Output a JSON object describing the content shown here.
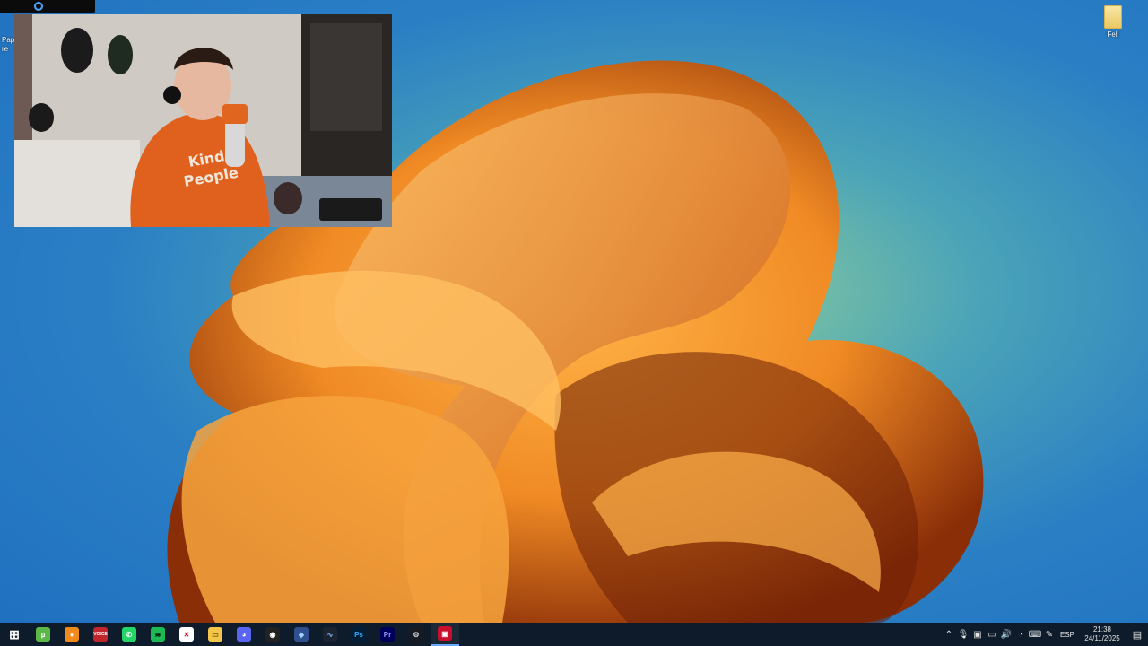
{
  "desktop": {
    "left_icon_label": "Pap re",
    "right_icon_label": "Feli"
  },
  "taskbar": {
    "apps": [
      {
        "name": "start-button",
        "glyph": "⊞",
        "bg": "#0d1b2a",
        "color": "#ffffff"
      },
      {
        "name": "app-utorrent",
        "glyph": "µ",
        "bg": "#5cb947",
        "color": "#ffffff"
      },
      {
        "name": "app-fl-studio",
        "glyph": "♦",
        "bg": "#f08a1c",
        "color": "#ffffff"
      },
      {
        "name": "app-voicemeeter",
        "glyph": "VOICE",
        "bg": "#c0262c",
        "color": "#ffffff"
      },
      {
        "name": "app-whatsapp",
        "glyph": "✆",
        "bg": "#25d366",
        "color": "#ffffff"
      },
      {
        "name": "app-spotify",
        "glyph": "≋",
        "bg": "#1db954",
        "color": "#000000"
      },
      {
        "name": "app-x-red",
        "glyph": "✕",
        "bg": "#ffffff",
        "color": "#d12"
      },
      {
        "name": "app-file-explorer",
        "glyph": "▭",
        "bg": "#f3c64a",
        "color": "#7a5a00"
      },
      {
        "name": "app-discord",
        "glyph": "◕",
        "bg": "#5865f2",
        "color": "#ffffff"
      },
      {
        "name": "app-obs",
        "glyph": "◉",
        "bg": "#222222",
        "color": "#ffffff"
      },
      {
        "name": "app-diamond",
        "glyph": "◆",
        "bg": "#2f4f8f",
        "color": "#9fd0ff"
      },
      {
        "name": "app-audio-editor",
        "glyph": "∿",
        "bg": "#1b2430",
        "color": "#7fb3ff"
      },
      {
        "name": "app-photoshop",
        "glyph": "Ps",
        "bg": "#001e36",
        "color": "#31a8ff"
      },
      {
        "name": "app-premiere",
        "glyph": "Pr",
        "bg": "#00005b",
        "color": "#9999ff"
      },
      {
        "name": "app-steam",
        "glyph": "⚙",
        "bg": "#171a21",
        "color": "#c7d5e0"
      },
      {
        "name": "app-red-active",
        "glyph": "▣",
        "bg": "#c8102e",
        "color": "#ffffff"
      }
    ],
    "tray": {
      "chevron": "⌃",
      "mic": "🎙",
      "icon3": "▣",
      "icon4": "▭",
      "volume": "🔊",
      "icon6": "◔",
      "keyboard": "⌨",
      "pen": "✎",
      "language": "ESP",
      "time": "21:38",
      "date": "24/11/2025",
      "notifications": "▤"
    }
  }
}
